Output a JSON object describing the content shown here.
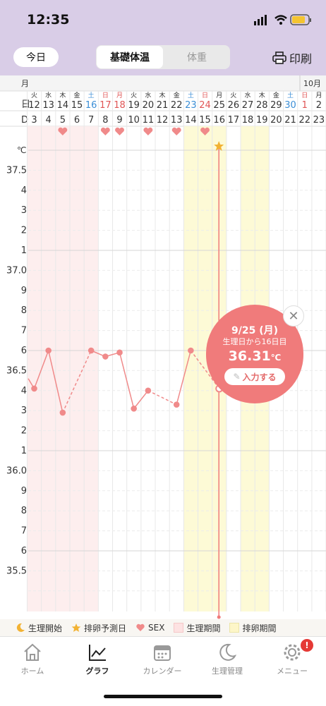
{
  "status": {
    "time": "12:35"
  },
  "header": {
    "today_label": "今日",
    "tabs": [
      "基礎体温",
      "体重"
    ],
    "print_label": "印刷"
  },
  "calendar": {
    "month_row_label": "月",
    "month_oct": "10月",
    "day_row_label": "日",
    "d_row_label": "D",
    "weekdays": [
      "火",
      "水",
      "木",
      "金",
      "土",
      "日",
      "月",
      "火",
      "水",
      "木",
      "金",
      "土",
      "日",
      "月",
      "火",
      "水",
      "木",
      "金",
      "土",
      "日",
      "月"
    ],
    "dates": [
      "12",
      "13",
      "14",
      "15",
      "16",
      "17",
      "18",
      "19",
      "20",
      "21",
      "22",
      "23",
      "24",
      "25",
      "26",
      "27",
      "28",
      "29",
      "30",
      "1",
      "2"
    ],
    "cycle_days": [
      "3",
      "4",
      "5",
      "6",
      "7",
      "8",
      "9",
      "10",
      "11",
      "12",
      "13",
      "14",
      "15",
      "16",
      "17",
      "18",
      "19",
      "20",
      "21",
      "22",
      "23"
    ],
    "holiday_dates": [
      "16",
      "17",
      "18",
      "23",
      "24",
      "30",
      "1"
    ],
    "sex_days": [
      "5",
      "8",
      "9",
      "11",
      "13",
      "15"
    ]
  },
  "chart_data": {
    "type": "line",
    "unit_label": "℃",
    "y_tick_labels": [
      "37.5",
      "4",
      "3",
      "2",
      "1",
      "37.0",
      "9",
      "8",
      "7",
      "6",
      "36.5",
      "4",
      "3",
      "2",
      "1",
      "36.0",
      "9",
      "8",
      "7",
      "6",
      "35.5"
    ],
    "ylim": [
      35.5,
      37.5
    ],
    "x": [
      "9/12",
      "9/13",
      "9/14",
      "9/15",
      "9/16",
      "9/17",
      "9/18",
      "9/19",
      "9/20",
      "9/21",
      "9/22",
      "9/23",
      "9/24",
      "9/25"
    ],
    "values": [
      36.31,
      36.5,
      36.19,
      null,
      36.5,
      36.47,
      36.49,
      36.21,
      36.3,
      null,
      36.23,
      36.5,
      null,
      36.31
    ],
    "period_days": [
      "9/12",
      "9/13",
      "9/14",
      "9/15",
      "9/16"
    ],
    "ovulation_days": [
      "9/23",
      "9/24",
      "9/25",
      "9/26",
      "9/27"
    ],
    "ovulation_predicted": "9/25",
    "selected": "9/25"
  },
  "popup": {
    "date": "9/25 (月)",
    "sub": "生理日から16日目",
    "temp": "36.31",
    "temp_unit": "℃",
    "button": "入力する"
  },
  "legend": [
    "生理開始",
    "排卵予測日",
    "SEX",
    "生理期間",
    "排卵期間"
  ],
  "tabs": [
    "ホーム",
    "グラフ",
    "カレンダー",
    "生理管理",
    "メニュー"
  ],
  "badge": "!",
  "colors": {
    "pink": "#f07b7b",
    "line": "#f08a8a",
    "period": "#fdeeee",
    "ovulation": "#fdfad6",
    "holiday_blue": "#3b8ed6",
    "holiday_red": "#e05555"
  }
}
